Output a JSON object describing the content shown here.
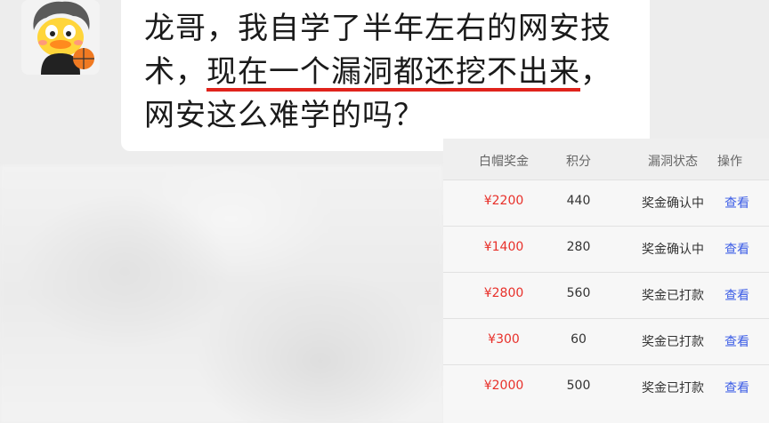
{
  "message": {
    "line1": "龙哥，我自学了半年左右的网安技",
    "line2_prefix": "术，",
    "line2_highlight": "现在一个漏洞都还挖不出来",
    "line2_suffix": "，",
    "line3": "网安这么难学的吗？"
  },
  "table": {
    "headers": [
      "白帽奖金",
      "积分",
      "漏洞状态",
      "操作"
    ],
    "rows": [
      {
        "amount": "¥2200",
        "points": "440",
        "status": "奖金确认中",
        "action": "查看"
      },
      {
        "amount": "¥1400",
        "points": "280",
        "status": "奖金确认中",
        "action": "查看"
      },
      {
        "amount": "¥2800",
        "points": "560",
        "status": "奖金已打款",
        "action": "查看"
      },
      {
        "amount": "¥300",
        "points": "60",
        "status": "奖金已打款",
        "action": "查看"
      },
      {
        "amount": "¥2000",
        "points": "500",
        "status": "奖金已打款",
        "action": "查看"
      }
    ]
  },
  "colors": {
    "amount": "#e8302a",
    "action": "#3b5ce6",
    "highlight_underline": "#e0231c"
  },
  "icons": {
    "avatar": "duck-avatar-icon"
  }
}
